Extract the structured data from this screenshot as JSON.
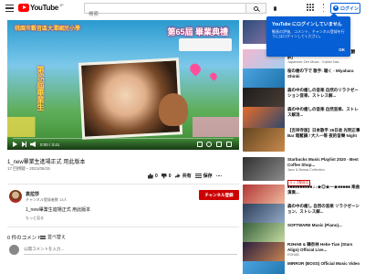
{
  "header": {
    "logo_text": "YouTube",
    "logo_region": "JP",
    "search_placeholder": "検索",
    "login_label": "ログイン"
  },
  "player": {
    "overlay_school": "桃園市觀音區大潭國民小學",
    "overlay_graduation": "第65屆 畢業典禮",
    "overlay_vertical": "第65屆畢業生",
    "time": "0:00 / 3:41",
    "progress": 0.0
  },
  "video": {
    "title": "1_new畢業生進場正式 用此版本",
    "meta": "17 回視聴・2021/06/15",
    "likes": "0",
    "dislikes": "0",
    "share": "共有",
    "save": "保存"
  },
  "channel": {
    "name": "袁拉莎",
    "subscribers": "チャンネル登録者数 13人",
    "subscribe_label": "チャンネル登録",
    "description": "1_new畢業生進場正式 用此版本",
    "show_more": "もっと見る"
  },
  "comments": {
    "count": "0 件のコメント",
    "sort_label": "並べ替え",
    "input_placeholder": "公開コメントを入力..."
  },
  "popup": {
    "title": "YouTube にログインしていません",
    "body": "動画の評価、コメント、チャンネル登録を行うにはログインしてください。",
    "ok": "OK"
  },
  "recommendations": [
    {
      "title": "Afternoon Jazz Lounge ...",
      "channel": "",
      "meta": "",
      "duration": ""
    },
    {
      "title": "【MV】 x 洋楽歌 演奏作・発表歌 (翻訳)",
      "channel": "Japanese Zen Music · Kaihei Nat...",
      "meta": "",
      "duration": ""
    },
    {
      "title": "桜の樹の下で 歌手: 聴く - Miyahara Shinki",
      "channel": "",
      "meta": "",
      "duration": ""
    },
    {
      "title": "森の中の癒しの音楽 自然のリラクゼーション音楽、ストレス解...",
      "channel": "",
      "meta": "",
      "duration": ""
    },
    {
      "title": "森の中の癒しの音楽 自然音楽、ストレス解消...",
      "channel": "",
      "meta": "",
      "duration": ""
    },
    {
      "title": "【吉祥寺版】日本歌手 26日收 光明正事 Bar 暗藍調 / 大人一等 夜的音樂 Night piano 【25 音樂】",
      "channel": "",
      "meta": "",
      "duration": ""
    },
    {
      "title": "Starbucks Music Playlist 2020 - Best Coffee Shop...",
      "channel": "Jazz & Bossa Collection",
      "meta": "",
      "duration": "",
      "live": "ライブ配信中"
    },
    {
      "title": "■■■■■■■■■■♫♪★◎★一★■■■■■ 楽曲演奏...",
      "channel": "",
      "meta": "",
      "duration": ""
    },
    {
      "title": "森の中の癒し 自然の音楽 リラクゼーション、ストレス解...",
      "channel": "",
      "meta": "",
      "duration": ""
    },
    {
      "title": "SOFTWARE Music (Piano)...",
      "channel": "",
      "meta": "",
      "duration": ""
    },
    {
      "title": "R3HAB & 韓奈林 Hebe Tian (Stars Align) Official Live...",
      "channel": "R3HAB",
      "meta": "",
      "duration": ""
    },
    {
      "title": "MIRROR (BOSS) Official Music Video",
      "channel": "",
      "meta": "",
      "duration": ""
    }
  ]
}
